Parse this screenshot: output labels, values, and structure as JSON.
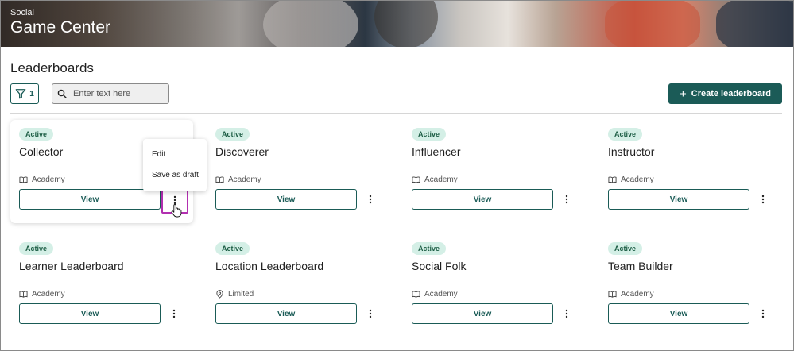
{
  "header": {
    "eyebrow": "Social",
    "title": "Game Center"
  },
  "page": {
    "title": "Leaderboards"
  },
  "toolbar": {
    "filter_count": "1",
    "search_placeholder": "Enter text here",
    "search_value": "",
    "create_label": "Create leaderboard"
  },
  "colors": {
    "accent": "#1b5b57",
    "badge_bg": "#d4efe6",
    "badge_text": "#1d5e45",
    "highlight": "#b22fb0"
  },
  "cards": [
    {
      "status": "Active",
      "title": "Collector",
      "meta_icon": "book-icon",
      "meta": "Academy",
      "view_label": "View"
    },
    {
      "status": "Active",
      "title": "Discoverer",
      "meta_icon": "book-icon",
      "meta": "Academy",
      "view_label": "View"
    },
    {
      "status": "Active",
      "title": "Influencer",
      "meta_icon": "book-icon",
      "meta": "Academy",
      "view_label": "View"
    },
    {
      "status": "Active",
      "title": "Instructor",
      "meta_icon": "book-icon",
      "meta": "Academy",
      "view_label": "View"
    },
    {
      "status": "Active",
      "title": "Learner Leaderboard",
      "meta_icon": "book-icon",
      "meta": "Academy",
      "view_label": "View"
    },
    {
      "status": "Active",
      "title": "Location Leaderboard",
      "meta_icon": "location-pin-icon",
      "meta": "Limited",
      "view_label": "View"
    },
    {
      "status": "Active",
      "title": "Social Folk",
      "meta_icon": "book-icon",
      "meta": "Academy",
      "view_label": "View"
    },
    {
      "status": "Active",
      "title": "Team Builder",
      "meta_icon": "book-icon",
      "meta": "Academy",
      "view_label": "View"
    }
  ],
  "context_menu": {
    "items": [
      {
        "label": "Edit"
      },
      {
        "label": "Save as draft"
      }
    ]
  }
}
